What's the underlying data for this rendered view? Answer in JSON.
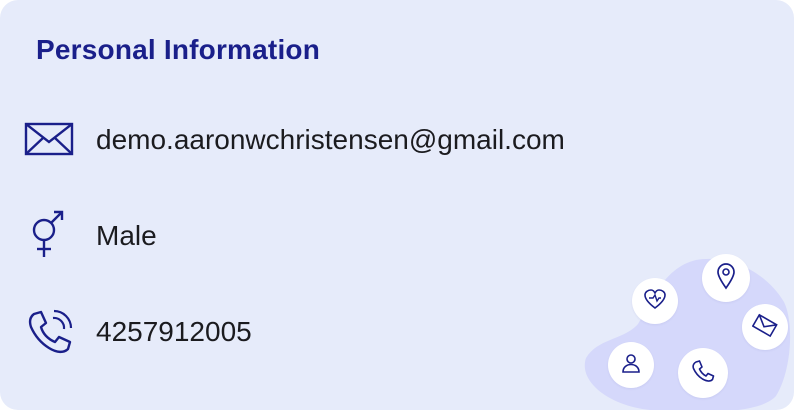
{
  "card": {
    "title": "Personal Information",
    "rows": [
      {
        "icon": "envelope-icon",
        "value": "demo.aaronwchristensen@gmail.com"
      },
      {
        "icon": "gender-icon",
        "value": "Male"
      },
      {
        "icon": "phone-icon",
        "value": "4257912005"
      }
    ]
  },
  "decoration": {
    "icons": [
      "heart-icon",
      "location-pin-icon",
      "mail-icon",
      "person-icon",
      "phone-icon"
    ]
  },
  "colors": {
    "card_background": "#e6ebfa",
    "title": "#1a1f8a",
    "icon": "#1a1f8a",
    "text": "#1b1b1f",
    "blob": "#d5d8fb"
  }
}
